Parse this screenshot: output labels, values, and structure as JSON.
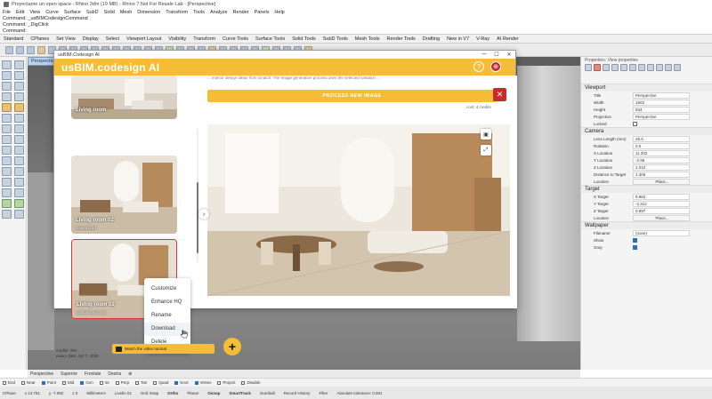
{
  "window": {
    "title": "Proyectame un open space - Rhino 3dm (19 MB) - Rhino 7 Not For Resale Lab - [Perspective]"
  },
  "menubar": [
    "File",
    "Edit",
    "View",
    "Curve",
    "Surface",
    "SubD",
    "Solid",
    "Mesh",
    "Dimension",
    "Transform",
    "Tools",
    "Analyze",
    "Render",
    "Panels",
    "Help"
  ],
  "command_history": [
    "Command: _usBIMCodesignCommand",
    "Command: _DigClick",
    "Command:"
  ],
  "toolbar_tabs": [
    "Standard",
    "CPlanes",
    "Set View",
    "Display",
    "Select",
    "Viewport Layout",
    "Visibility",
    "Transform",
    "Curve Tools",
    "Surface Tools",
    "Solid Tools",
    "SubD Tools",
    "Mesh Tools",
    "Render Tools",
    "Drafting",
    "New in V7",
    "V-Ray",
    "AI Render"
  ],
  "viewport": {
    "label": "Perspective"
  },
  "dialog": {
    "window_title": "usBIM.Codesign AI",
    "controls": [
      "—",
      "☐",
      "✕"
    ],
    "logo_prefix": "us",
    "logo_bim": "BIM",
    "logo_rest": ".codesign AI",
    "help_icon": "?",
    "language_icon": "⊕",
    "gallery": [
      {
        "label": "Living room",
        "sub": ""
      },
      {
        "label": "Living room 02",
        "sub": "customized"
      },
      {
        "label": "Living room 02",
        "sub": "customized | HQ"
      }
    ],
    "context_menu": [
      "Customize",
      "Enhance HQ",
      "Rename",
      "Download",
      "Delete"
    ],
    "credits_line": "credits: 294",
    "expiry_line": "expiry date: Apr 7, 2026",
    "tutorial_label": "Watch the video tutorial",
    "add_label": "+",
    "cut_text": "... interior design ideas from scratch. The image generation process uses the selected variation ...",
    "process_label": "PROCESS NEW IMAGE",
    "close_label": "✕",
    "cost_label": "cost: 4 credits",
    "nav_label": "›",
    "save_icon": "▣",
    "expand_icon": "⤢"
  },
  "properties": {
    "panel_title": "Properties: View properties",
    "sections": [
      {
        "name": "Viewport",
        "rows": [
          {
            "k": "Title",
            "v": "Perspective"
          },
          {
            "k": "Width",
            "v": "1503"
          },
          {
            "k": "Height",
            "v": "834"
          },
          {
            "k": "Projection",
            "v": "Perspective"
          },
          {
            "k": "Locked",
            "v": "",
            "check": false
          }
        ]
      },
      {
        "name": "Camera",
        "rows": [
          {
            "k": "Lens Length (mm)",
            "v": "25.0"
          },
          {
            "k": "Rotation",
            "v": "0.0"
          },
          {
            "k": "X Location",
            "v": "11.202"
          },
          {
            "k": "Y Location",
            "v": "-2.96"
          },
          {
            "k": "Z Location",
            "v": "1.012"
          },
          {
            "k": "Distance to Target",
            "v": "1.306"
          },
          {
            "k": "Location",
            "v": "Place...",
            "btn": true
          }
        ]
      },
      {
        "name": "Target",
        "rows": [
          {
            "k": "X Target",
            "v": "9.882"
          },
          {
            "k": "Y Target",
            "v": "-2.312"
          },
          {
            "k": "Z Target",
            "v": "0.897"
          },
          {
            "k": "Location",
            "v": "Place...",
            "btn": true
          }
        ]
      },
      {
        "name": "Wallpaper",
        "rows": [
          {
            "k": "Filename",
            "v": "(none)"
          },
          {
            "k": "Show",
            "v": "",
            "check": true
          },
          {
            "k": "Gray",
            "v": "",
            "check": true
          }
        ]
      }
    ]
  },
  "view_tabs": [
    "Perspective",
    "Superior",
    "Frontale",
    "Destra",
    "⊕"
  ],
  "osnap": [
    {
      "label": "End",
      "on": false
    },
    {
      "label": "Near",
      "on": false
    },
    {
      "label": "Point",
      "on": true
    },
    {
      "label": "Mid",
      "on": false
    },
    {
      "label": "Cen",
      "on": true
    },
    {
      "label": "Int",
      "on": false
    },
    {
      "label": "Perp",
      "on": false
    },
    {
      "label": "Tan",
      "on": false
    },
    {
      "label": "Quad",
      "on": false
    },
    {
      "label": "Knot",
      "on": true
    },
    {
      "label": "Vertex",
      "on": true
    },
    {
      "label": "Project",
      "on": false
    },
    {
      "label": "Disable",
      "on": false
    }
  ],
  "status": {
    "cplane": "CPlane",
    "x": "x 13.751",
    "y": "y -7.082",
    "z": "z 0",
    "units": "Millimeters",
    "layer": "Livello 01",
    "grid_snap": "Grid Snap",
    "ortho": "Ortho",
    "planar": "Planar",
    "osnap": "Osnap",
    "smarttrack": "SmartTrack",
    "gumball": "Gumball",
    "record_history": "Record History",
    "filter": "Filter",
    "tolerance": "Absolute tolerance: 0.001"
  },
  "colors": {
    "accent": "#f4bd35",
    "danger": "#c92b2b",
    "viewport_label": "#bcd0e8"
  }
}
